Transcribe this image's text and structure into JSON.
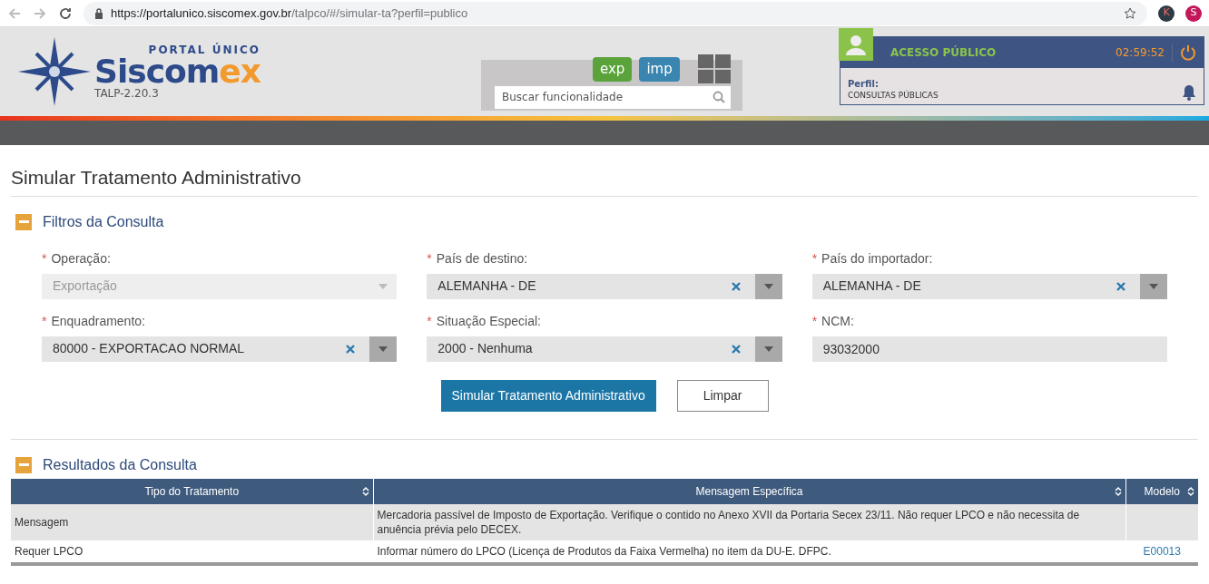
{
  "browser": {
    "url_host": "https://portalunico.siscomex.gov.br",
    "url_path": "/talpco/#/simular-ta?perfil=publico",
    "profile_letters": [
      "K",
      "S"
    ]
  },
  "header": {
    "logo_top": "PORTAL ÚNICO",
    "logo_main": "Siscom",
    "logo_accent": "ex",
    "version": "TALP-2.20.3",
    "modes": [
      {
        "label": "exp",
        "color": "#5aa33b"
      },
      {
        "label": "imp",
        "color": "#3a86b0"
      }
    ],
    "search": {
      "placeholder": "Buscar funcionalidade"
    },
    "session": {
      "title": "ACESSO PÚBLICO",
      "timer": "02:59:52",
      "profile_label": "Perfil:",
      "profile_value": "CONSULTAS PÚBLICAS"
    }
  },
  "page_title": "Simular Tratamento Administrativo",
  "filters": {
    "title": "Filtros da Consulta",
    "expanded": true,
    "fields": [
      {
        "required_mark": "*",
        "label": "Operação:",
        "kind": "select",
        "value": "Exportação",
        "disabled": true
      },
      {
        "required_mark": "*",
        "label": "País de destino:",
        "kind": "select",
        "value": "ALEMANHA - DE",
        "disabled": false
      },
      {
        "required_mark": "*",
        "label": "País do importador:",
        "kind": "select",
        "value": "ALEMANHA - DE",
        "disabled": false
      },
      {
        "required_mark": "*",
        "label": "Enquadramento:",
        "kind": "select",
        "value": "80000 - EXPORTACAO NORMAL",
        "disabled": false
      },
      {
        "required_mark": "*",
        "label": "Situação Especial:",
        "kind": "select",
        "value": "2000 - Nenhuma",
        "disabled": false
      },
      {
        "required_mark": "*",
        "label": "NCM:",
        "kind": "text",
        "value": "93032000",
        "disabled": false
      }
    ],
    "buttons": [
      {
        "label": "Simular Tratamento Administrativo",
        "kind": "primary"
      },
      {
        "label": "Limpar",
        "kind": "secondary"
      }
    ]
  },
  "results": {
    "title": "Resultados da Consulta",
    "expanded": true,
    "columns": [
      "Tipo do Tratamento",
      "Mensagem Específica",
      "Modelo"
    ],
    "rows": [
      {
        "cells": [
          "Mensagem",
          "Mercadoria passível de Imposto de Exportação. Verifique o contido no Anexo XVII da Portaria Secex 23/11. Não requer LPCO e não necessita de anuência prévia pelo DECEX.",
          ""
        ]
      },
      {
        "cells": [
          "Requer LPCO",
          "Informar número do LPCO (Licença de Produtos da Faixa Vermelha) no item da DU-E. DFPC.",
          "E00013"
        ]
      }
    ]
  }
}
